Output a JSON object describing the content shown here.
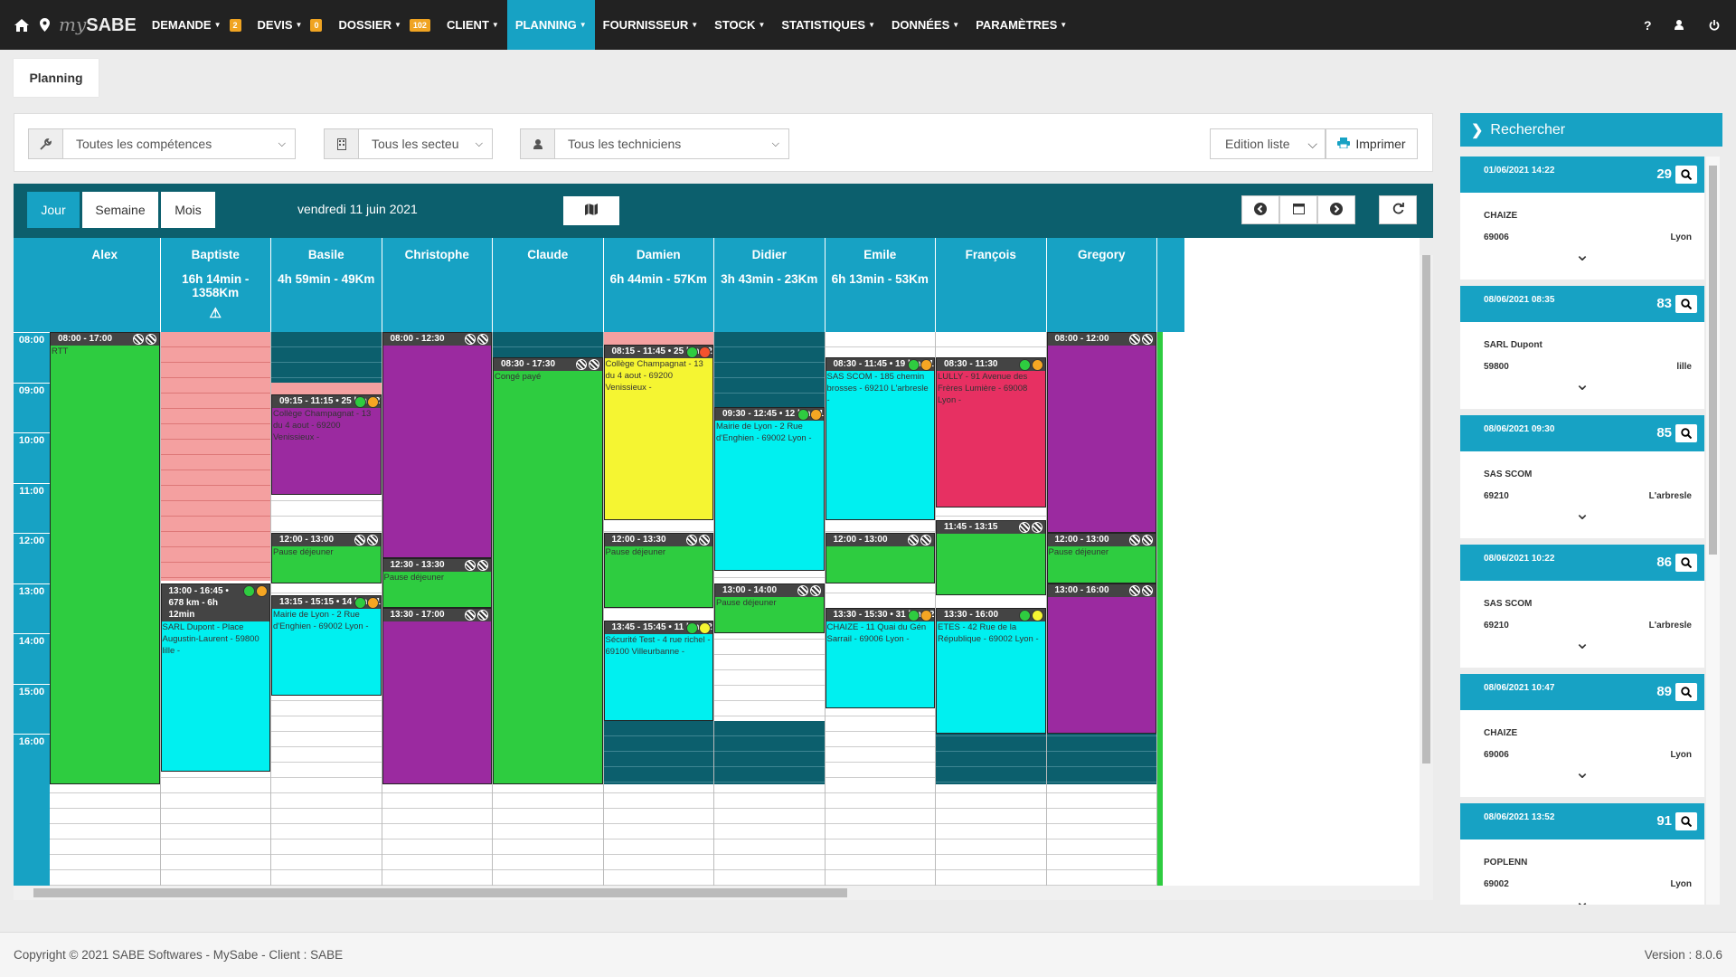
{
  "nav": {
    "brand_prefix": "my",
    "brand": "SABE",
    "items": [
      {
        "label": "DEMANDE",
        "badge": "2"
      },
      {
        "label": "DEVIS",
        "badge": "0"
      },
      {
        "label": "DOSSIER",
        "badge": "102"
      },
      {
        "label": "CLIENT",
        "badge": null
      },
      {
        "label": "PLANNING",
        "badge": null,
        "active": true
      },
      {
        "label": "FOURNISSEUR",
        "badge": null
      },
      {
        "label": "STOCK",
        "badge": null
      },
      {
        "label": "STATISTIQUES",
        "badge": null
      },
      {
        "label": "DONNÉES",
        "badge": null
      },
      {
        "label": "PARAMÈTRES",
        "badge": null
      }
    ],
    "right": [
      "?",
      "user-icon",
      "power-icon"
    ]
  },
  "page": {
    "tab": "Planning"
  },
  "filters": {
    "competences": "Toutes les compétences",
    "secteurs": "Tous les secteu",
    "techniciens": "Tous les techniciens",
    "edition": "Edition liste",
    "print": "Imprimer"
  },
  "views": {
    "jour": "Jour",
    "semaine": "Semaine",
    "mois": "Mois",
    "date": "vendredi 11 juin 2021"
  },
  "hours": [
    "08:00",
    "09:00",
    "10:00",
    "11:00",
    "12:00",
    "13:00",
    "14:00",
    "15:00",
    "16:00"
  ],
  "colors": {
    "accent": "#17a2c4",
    "dark": "#0c5f6d",
    "topbar": "#222222",
    "badge": "#f0a422"
  },
  "techs": [
    {
      "name": "Alex",
      "sub": "",
      "warn": false,
      "events": [
        {
          "time": "08:00 - 17:00",
          "desc": "RTT",
          "color": "green",
          "start": 0,
          "end": 9,
          "mark": "hatch"
        }
      ]
    },
    {
      "name": "Baptiste",
      "sub": "16h 14min - 1358Km",
      "warn": true,
      "events": [
        {
          "time": "13:00 - 16:45 • 678 km - 6h 12min",
          "desc": "SARL Dupont - Place Augustin-Laurent - 59800 lille -",
          "color": "cyan",
          "start": 5,
          "end": 8.75,
          "mark": "dots",
          "tall": true,
          "dots": [
            "#2ecc40",
            "#f5a623"
          ]
        }
      ]
    },
    {
      "name": "Basile",
      "sub": "4h 59min - 49Km",
      "warn": false,
      "events": [
        {
          "time": "09:15 - 11:15 • 25 km - 27min",
          "desc": "Collège Champagnat - 13 du 4 aout - 69200 Venissieux -",
          "color": "purple",
          "start": 1.25,
          "end": 3.25,
          "mark": "dots",
          "dots": [
            "#2ecc40",
            "#f5a623"
          ]
        },
        {
          "time": "12:00 - 13:00",
          "desc": "Pause déjeuner",
          "color": "green",
          "start": 4,
          "end": 5,
          "mark": "hatch"
        },
        {
          "time": "13:15 - 15:15 • 14 km - 18min",
          "desc": "Mairie de Lyon - 2 Rue d'Enghien - 69002 Lyon -",
          "color": "cyan",
          "start": 5.25,
          "end": 7.25,
          "mark": "dots",
          "dots": [
            "#2ecc40",
            "#f5a623"
          ]
        }
      ]
    },
    {
      "name": "Christophe",
      "sub": "",
      "warn": false,
      "events": [
        {
          "time": "08:00 - 12:30",
          "desc": "",
          "color": "purple",
          "start": 0,
          "end": 4.5,
          "mark": "hatch"
        },
        {
          "time": "12:30 - 13:30",
          "desc": "Pause déjeuner",
          "color": "green",
          "start": 4.5,
          "end": 5.5,
          "mark": "hatch"
        },
        {
          "time": "13:30 - 17:00",
          "desc": "",
          "color": "purple",
          "start": 5.5,
          "end": 9,
          "mark": "hatch"
        }
      ]
    },
    {
      "name": "Claude",
      "sub": "",
      "warn": false,
      "events": [
        {
          "time": "08:30 - 17:30",
          "desc": "Congé payé",
          "color": "green",
          "start": 0.5,
          "end": 9,
          "mark": "hatch"
        }
      ]
    },
    {
      "name": "Damien",
      "sub": "6h 44min - 57Km",
      "warn": false,
      "events": [
        {
          "time": "08:15 - 11:45 • 25 km - 27min",
          "desc": "Collège Champagnat - 13 du 4 aout - 69200 Venissieux -",
          "color": "yellow",
          "start": 0.25,
          "end": 3.75,
          "mark": "dots",
          "dots": [
            "#2ecc40",
            "#f5532e"
          ]
        },
        {
          "time": "12:00 - 13:30",
          "desc": "Pause déjeuner",
          "color": "green",
          "start": 4,
          "end": 5.5,
          "mark": "hatch"
        },
        {
          "time": "13:45 - 15:45 • 11 km - 21min",
          "desc": "Sécurité Test - 4 rue richel - 69100 Villeurbanne -",
          "color": "cyan",
          "start": 5.75,
          "end": 7.75,
          "mark": "dots",
          "dots": [
            "#2ecc40",
            "#f5f532"
          ]
        }
      ]
    },
    {
      "name": "Didier",
      "sub": "3h 43min - 23Km",
      "warn": false,
      "events": [
        {
          "time": "09:30 - 12:45 • 12 km - 15min",
          "desc": "Mairie de Lyon - 2 Rue d'Enghien - 69002 Lyon -",
          "color": "cyan",
          "start": 1.5,
          "end": 4.75,
          "mark": "dots",
          "dots": [
            "#2ecc40",
            "#f5a623"
          ]
        },
        {
          "time": "13:00 - 14:00",
          "desc": "Pause déjeuner",
          "color": "green",
          "start": 5,
          "end": 6,
          "mark": "hatch"
        }
      ]
    },
    {
      "name": "Emile",
      "sub": "6h 13min - 53Km",
      "warn": false,
      "events": [
        {
          "time": "08:30 - 11:45 • 19 km - 17min",
          "desc": "SAS SCOM - 185 chemin brosses - 69210 L'arbresle -",
          "color": "cyan",
          "start": 0.5,
          "end": 3.75,
          "mark": "dots",
          "dots": [
            "#2ecc40",
            "#f5a623"
          ]
        },
        {
          "time": "12:00 - 13:00",
          "desc": "",
          "color": "green",
          "start": 4,
          "end": 5,
          "mark": "hatch"
        },
        {
          "time": "13:30 - 15:30 • 31 km - 29min",
          "desc": "CHAIZE - 11 Quai du Gén Sarrail - 69006 Lyon -",
          "color": "cyan",
          "start": 5.5,
          "end": 7.5,
          "mark": "dots",
          "dots": [
            "#2ecc40",
            "#f5a623"
          ]
        }
      ]
    },
    {
      "name": "François",
      "sub": "",
      "warn": false,
      "events": [
        {
          "time": "08:30 - 11:30",
          "desc": "LULLY - 91 Avenue des Frères Lumière - 69008 Lyon -",
          "color": "red",
          "start": 0.5,
          "end": 3.5,
          "mark": "dots",
          "dots": [
            "#2ecc40",
            "#f5a623"
          ]
        },
        {
          "time": "11:45 - 13:15",
          "desc": "",
          "color": "green",
          "start": 3.75,
          "end": 5.25,
          "mark": "hatch"
        },
        {
          "time": "13:30 - 16:00",
          "desc": "ETES - 42 Rue de la République - 69002 Lyon -",
          "color": "cyan",
          "start": 5.5,
          "end": 8,
          "mark": "dots",
          "dots": [
            "#2ecc40",
            "#f5f532"
          ]
        }
      ]
    },
    {
      "name": "Gregory",
      "sub": "",
      "warn": false,
      "events": [
        {
          "time": "08:00 - 12:00",
          "desc": "",
          "color": "purple",
          "start": 0,
          "end": 4,
          "mark": "hatch"
        },
        {
          "time": "12:00 - 13:00",
          "desc": "Pause déjeuner",
          "color": "green",
          "start": 4,
          "end": 5,
          "mark": "hatch"
        },
        {
          "time": "13:00 - 16:00",
          "desc": "",
          "color": "purple",
          "start": 5,
          "end": 8,
          "mark": "hatch"
        }
      ]
    }
  ],
  "search": {
    "title": "Rechercher",
    "results": [
      {
        "date": "01/06/2021 14:22",
        "num": "29",
        "name": "CHAIZE",
        "zip": "69006",
        "city": "Lyon"
      },
      {
        "date": "08/06/2021 08:35",
        "num": "83",
        "name": "SARL Dupont",
        "zip": "59800",
        "city": "lille"
      },
      {
        "date": "08/06/2021 09:30",
        "num": "85",
        "name": "SAS SCOM",
        "zip": "69210",
        "city": "L'arbresle"
      },
      {
        "date": "08/06/2021 10:22",
        "num": "86",
        "name": "SAS SCOM",
        "zip": "69210",
        "city": "L'arbresle"
      },
      {
        "date": "08/06/2021 10:47",
        "num": "89",
        "name": "CHAIZE",
        "zip": "69006",
        "city": "Lyon"
      },
      {
        "date": "08/06/2021 13:52",
        "num": "91",
        "name": "POPLENN",
        "zip": "69002",
        "city": "Lyon"
      }
    ]
  },
  "footer": {
    "copyright": "Copyright © 2021 SABE Softwares - MySabe - Client : SABE",
    "version": "Version : 8.0.6"
  }
}
